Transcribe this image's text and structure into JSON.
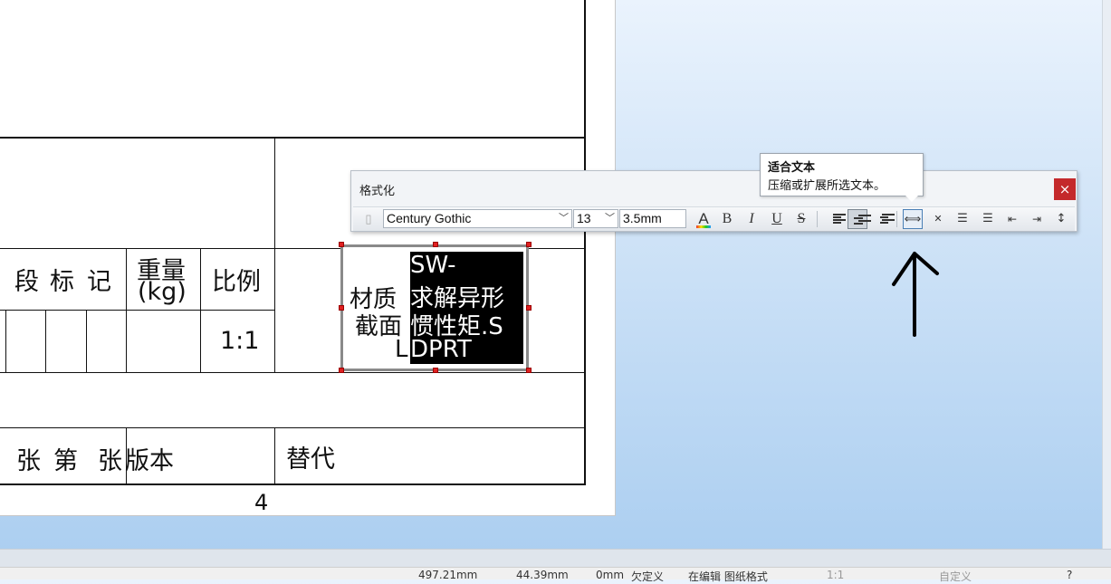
{
  "drawing": {
    "header_cells": [
      "段",
      "标",
      "记",
      "重量",
      "(kg)",
      "比例"
    ],
    "scale_value": "1:1",
    "bottom_cells": [
      "张",
      "第",
      "张",
      "版本",
      "替代"
    ],
    "zone_number": "4"
  },
  "note": {
    "left_text_lines": [
      "材质",
      "截面",
      "L"
    ],
    "selected_text_lines": [
      "SW-",
      "求解异形",
      "惯性矩.S",
      "DPRT"
    ]
  },
  "format_toolbar": {
    "title": "格式化",
    "close_label": "×",
    "font_name": "Century Gothic",
    "font_size": "13",
    "text_height": "3.5mm",
    "color_label": "A",
    "bold_label": "B",
    "italic_label": "I",
    "underline_label": "U",
    "strike_label": "S"
  },
  "tooltip": {
    "title": "适合文本",
    "description": "压缩或扩展所选文本。"
  },
  "statusbar": {
    "x_coord": "497.21mm",
    "y_coord": "44.39mm",
    "z_coord": "0mm",
    "status_defined": "欠定义",
    "editing": "在编辑 图纸格式",
    "scale": "1:1",
    "units": "自定义"
  },
  "icons": [
    "font-style-icon",
    "text-color-icon",
    "align-left-icon",
    "align-center-icon",
    "align-right-icon",
    "fit-text-icon",
    "stack-icon",
    "bullets-icon",
    "numbering-icon",
    "decrease-indent-icon",
    "increase-indent-icon",
    "line-spacing-icon"
  ],
  "colors": {
    "close": "#c4292b",
    "handle": "#e02020"
  }
}
